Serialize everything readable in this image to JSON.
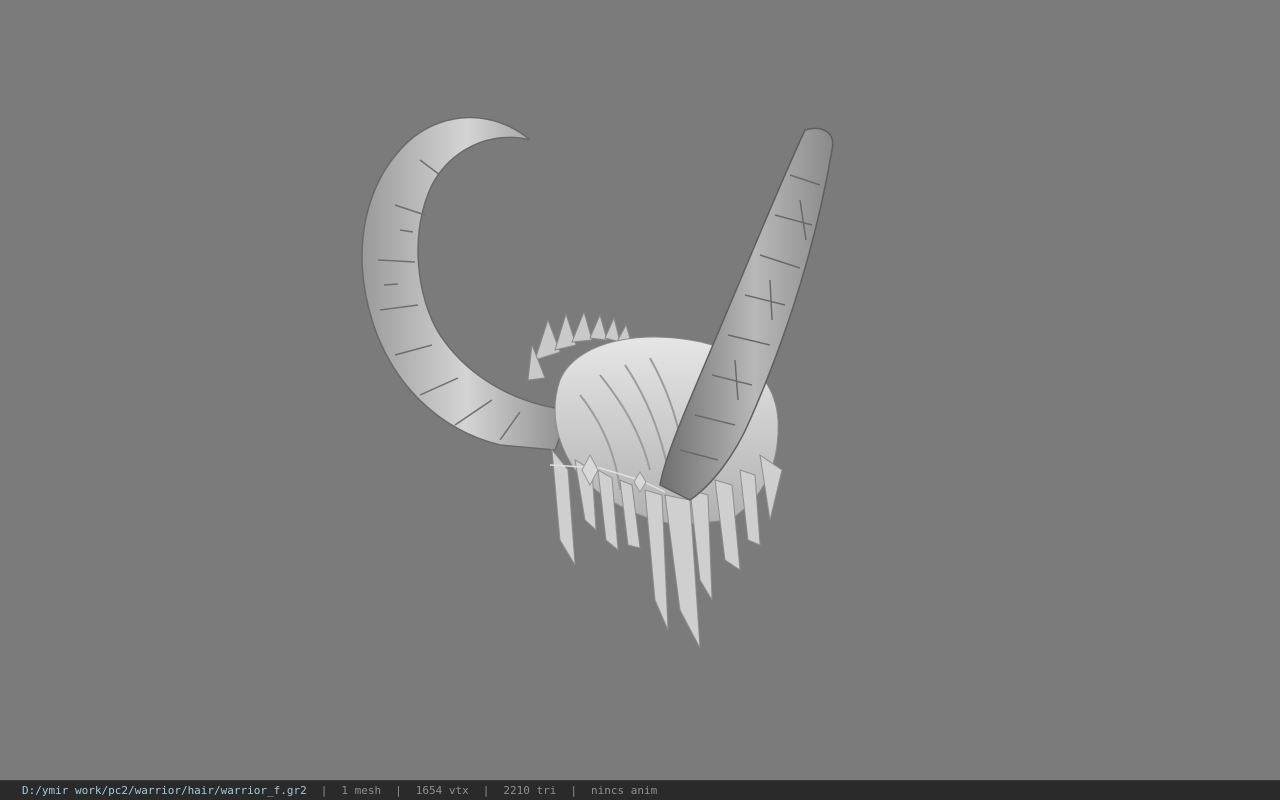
{
  "viewer": {
    "background_color": "#7b7b7b",
    "model_icon": "horned-helmet-model"
  },
  "status": {
    "file_path": "D:/ymir work/pc2/warrior/hair/warrior_f.gr2",
    "mesh_count": "1 mesh",
    "vertex_count": "1654 vtx",
    "triangle_count": "2210 tri",
    "anim_status": "nincs anim",
    "separator": "|"
  }
}
